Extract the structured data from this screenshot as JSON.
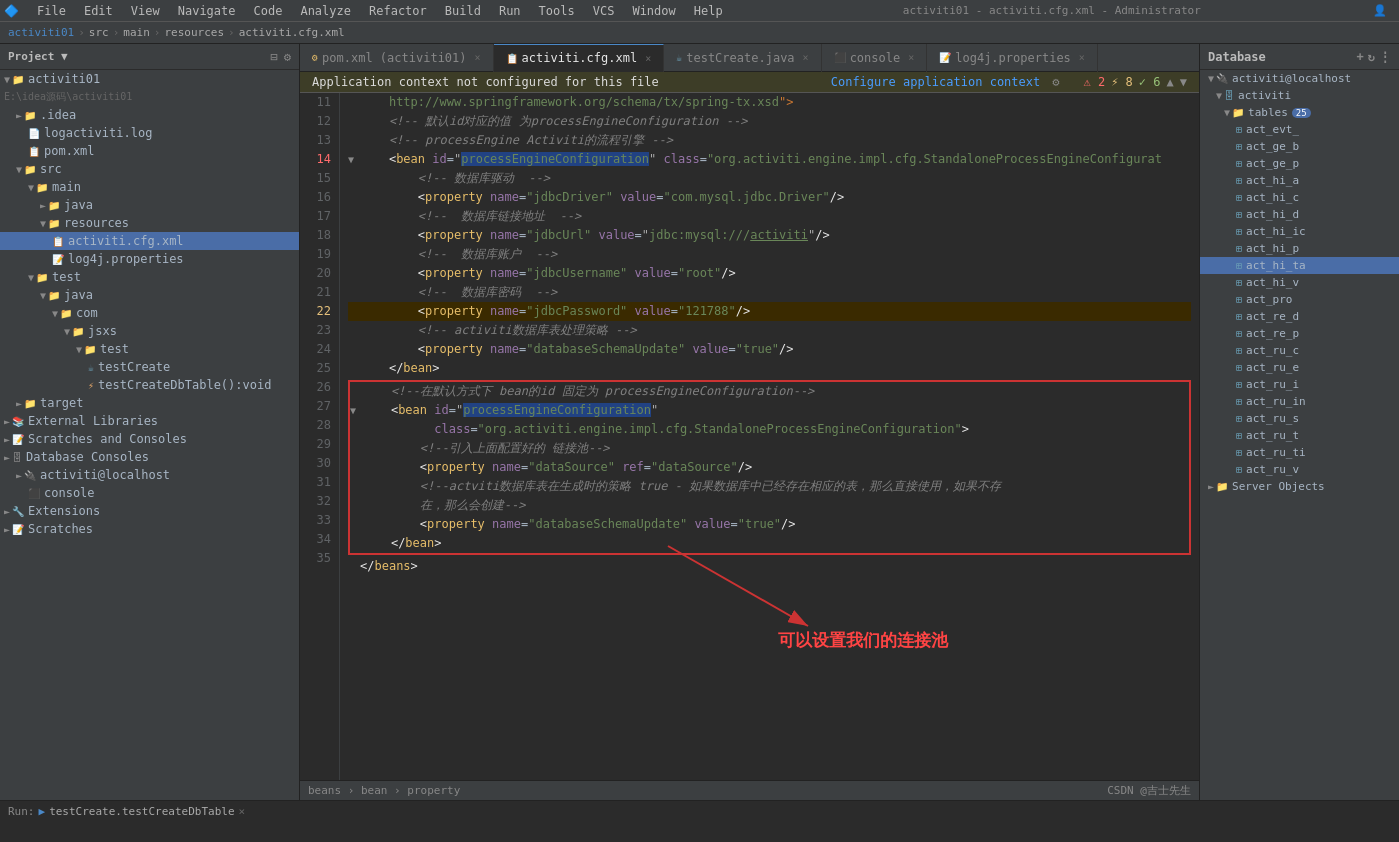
{
  "menuBar": {
    "items": [
      "File",
      "Edit",
      "View",
      "Navigate",
      "Code",
      "Analyze",
      "Refactor",
      "Build",
      "Run",
      "Tools",
      "VCS",
      "Window",
      "Help"
    ]
  },
  "windowTitle": "activiti01 - activiti.cfg.xml - Administrator",
  "breadcrumb": {
    "items": [
      "activiti01",
      "src",
      "main",
      "resources",
      "activiti.cfg.xml"
    ]
  },
  "tabs": [
    {
      "label": "pom.xml",
      "file": "pom.xml",
      "project": "activiti01",
      "active": false,
      "modified": false
    },
    {
      "label": "activiti.cfg.xml",
      "file": "activiti.cfg.xml",
      "active": true,
      "modified": false
    },
    {
      "label": "testCreate.java",
      "file": "testCreate.java",
      "active": false,
      "modified": false
    },
    {
      "label": "console",
      "file": "console",
      "active": false,
      "modified": false
    },
    {
      "label": "log4j.properties",
      "file": "log4j.properties",
      "active": false,
      "modified": false
    }
  ],
  "warningBar": {
    "message": "Application context not configured for this file",
    "configureLabel": "Configure application context"
  },
  "sidebar": {
    "title": "Project",
    "items": [
      {
        "label": "activiti01",
        "indent": 0,
        "type": "project",
        "arrow": "▼"
      },
      {
        "label": "E:\\idea源码\\activiti01",
        "indent": 0,
        "type": "path",
        "arrow": ""
      },
      {
        "label": ".idea",
        "indent": 1,
        "type": "folder",
        "arrow": "►"
      },
      {
        "label": "logactiviti.log",
        "indent": 1,
        "type": "file-log",
        "arrow": ""
      },
      {
        "label": "pom.xml",
        "indent": 1,
        "type": "file-xml",
        "arrow": ""
      },
      {
        "label": "src",
        "indent": 1,
        "type": "folder",
        "arrow": "▼"
      },
      {
        "label": "main",
        "indent": 2,
        "type": "folder",
        "arrow": "▼"
      },
      {
        "label": "java",
        "indent": 3,
        "type": "folder",
        "arrow": "►"
      },
      {
        "label": "resources",
        "indent": 3,
        "type": "folder",
        "arrow": "▼"
      },
      {
        "label": "activiti.cfg.xml",
        "indent": 4,
        "type": "file-xml",
        "arrow": "",
        "selected": true
      },
      {
        "label": "log4j.properties",
        "indent": 4,
        "type": "file-prop",
        "arrow": ""
      },
      {
        "label": "test",
        "indent": 2,
        "type": "folder",
        "arrow": "▼"
      },
      {
        "label": "java",
        "indent": 3,
        "type": "folder",
        "arrow": "▼"
      },
      {
        "label": "com",
        "indent": 4,
        "type": "folder",
        "arrow": "▼"
      },
      {
        "label": "jsxs",
        "indent": 5,
        "type": "folder",
        "arrow": "▼"
      },
      {
        "label": "test",
        "indent": 6,
        "type": "folder",
        "arrow": "▼"
      },
      {
        "label": "testCreate",
        "indent": 7,
        "type": "file-java",
        "arrow": ""
      },
      {
        "label": "testCreateDbTable():void",
        "indent": 7,
        "type": "file-method",
        "arrow": ""
      },
      {
        "label": "target",
        "indent": 1,
        "type": "folder",
        "arrow": "►"
      },
      {
        "label": "External Libraries",
        "indent": 0,
        "type": "folder",
        "arrow": "►"
      },
      {
        "label": "Scratches and Consoles",
        "indent": 0,
        "type": "folder",
        "arrow": "►"
      },
      {
        "label": "Database Consoles",
        "indent": 0,
        "type": "folder",
        "arrow": "►"
      },
      {
        "label": "activiti@localhost",
        "indent": 1,
        "type": "db",
        "arrow": "►"
      },
      {
        "label": "console",
        "indent": 2,
        "type": "console",
        "arrow": ""
      },
      {
        "label": "Extensions",
        "indent": 0,
        "type": "folder",
        "arrow": "►"
      },
      {
        "label": "Scratches",
        "indent": 0,
        "type": "folder",
        "arrow": "►"
      }
    ]
  },
  "dbPanel": {
    "title": "Database",
    "items": [
      {
        "label": "activiti@localhost",
        "indent": 0,
        "type": "db",
        "arrow": "▼"
      },
      {
        "label": "activiti",
        "indent": 1,
        "type": "schema",
        "arrow": "▼"
      },
      {
        "label": "tables",
        "indent": 2,
        "type": "folder",
        "arrow": "▼",
        "badge": "25"
      },
      {
        "label": "act_evt_",
        "indent": 3,
        "type": "table",
        "arrow": ""
      },
      {
        "label": "act_ge_b",
        "indent": 3,
        "type": "table",
        "arrow": ""
      },
      {
        "label": "act_ge_p",
        "indent": 3,
        "type": "table",
        "arrow": ""
      },
      {
        "label": "act_hi_a",
        "indent": 3,
        "type": "table",
        "arrow": ""
      },
      {
        "label": "act_hi_c",
        "indent": 3,
        "type": "table",
        "arrow": ""
      },
      {
        "label": "act_hi_d",
        "indent": 3,
        "type": "table",
        "arrow": ""
      },
      {
        "label": "act_hi_ic",
        "indent": 3,
        "type": "table",
        "arrow": ""
      },
      {
        "label": "act_hi_p",
        "indent": 3,
        "type": "table",
        "arrow": ""
      },
      {
        "label": "act_hi_ta",
        "indent": 3,
        "type": "table",
        "arrow": "",
        "selected": true
      },
      {
        "label": "act_hi_v",
        "indent": 3,
        "type": "table",
        "arrow": ""
      },
      {
        "label": "act_pro",
        "indent": 3,
        "type": "table",
        "arrow": ""
      },
      {
        "label": "act_re_d",
        "indent": 3,
        "type": "table",
        "arrow": ""
      },
      {
        "label": "act_re_p",
        "indent": 3,
        "type": "table",
        "arrow": ""
      },
      {
        "label": "act_ru_c",
        "indent": 3,
        "type": "table",
        "arrow": ""
      },
      {
        "label": "act_ru_e",
        "indent": 3,
        "type": "table",
        "arrow": ""
      },
      {
        "label": "act_ru_i",
        "indent": 3,
        "type": "table",
        "arrow": ""
      },
      {
        "label": "act_ru_in",
        "indent": 3,
        "type": "table",
        "arrow": ""
      },
      {
        "label": "act_ru_s",
        "indent": 3,
        "type": "table",
        "arrow": ""
      },
      {
        "label": "act_ru_t",
        "indent": 3,
        "type": "table",
        "arrow": ""
      },
      {
        "label": "act_ru_ti",
        "indent": 3,
        "type": "table",
        "arrow": ""
      },
      {
        "label": "act_ru_v",
        "indent": 3,
        "type": "table",
        "arrow": ""
      },
      {
        "label": "Server Objects",
        "indent": 0,
        "type": "folder",
        "arrow": "►"
      }
    ]
  },
  "codeLines": [
    {
      "num": 11,
      "content": "    http://www.springframework.org/schema/tx/spring-tx.xsd\">",
      "type": "normal"
    },
    {
      "num": 12,
      "content": "    <!-- 默认id对应的值 为processEngineConfiguration -->",
      "type": "comment"
    },
    {
      "num": 13,
      "content": "    <!-- processEngine Activiti的流程引擎 -->",
      "type": "comment"
    },
    {
      "num": 14,
      "content": "    <bean id=\"processEngineConfiguration\" class=\"org.activiti.engine.impl.cfg.StandaloneProcessEngineConfigurat",
      "type": "bean-highlight",
      "fold": true
    },
    {
      "num": 15,
      "content": "        <!-- 数据库驱动 -->",
      "type": "comment"
    },
    {
      "num": 16,
      "content": "        <property name=\"jdbcDriver\" value=\"com.mysql.jdbc.Driver\"/>",
      "type": "property"
    },
    {
      "num": 17,
      "content": "        <!--  数据库链接地址  -->",
      "type": "comment"
    },
    {
      "num": 18,
      "content": "        <property name=\"jdbcUrl\" value=\"jdbc:mysql:///activiti\"/>",
      "type": "property"
    },
    {
      "num": 19,
      "content": "        <!--  数据库账户  -->",
      "type": "comment"
    },
    {
      "num": 20,
      "content": "        <property name=\"jdbcUsername\" value=\"root\"/>",
      "type": "property"
    },
    {
      "num": 21,
      "content": "        <!--  数据库密码  -->",
      "type": "comment"
    },
    {
      "num": 22,
      "content": "        <property name=\"jdbcPassword\" value=\"121788\"/>",
      "type": "property-highlight"
    },
    {
      "num": 23,
      "content": "        <!-- activiti数据库表处理策略 -->",
      "type": "comment"
    },
    {
      "num": 24,
      "content": "        <property name=\"databaseSchemaUpdate\" value=\"true\"/>",
      "type": "property"
    },
    {
      "num": 25,
      "content": "    </bean>",
      "type": "normal"
    },
    {
      "num": 26,
      "content": "    <!--在默认方式下 bean的id 固定为 processEngineConfiguration-->",
      "type": "comment-box-start"
    },
    {
      "num": 27,
      "content": "    <bean id=\"processEngineConfiguration\"",
      "type": "bean-box",
      "fold": true
    },
    {
      "num": 28,
      "content": "          class=\"org.activiti.engine.impl.cfg.StandaloneProcessEngineConfiguration\">",
      "type": "bean-box"
    },
    {
      "num": 29,
      "content": "        <!--引入上面配置好的 链接池-->",
      "type": "comment-box"
    },
    {
      "num": 30,
      "content": "        <property name=\"dataSource\" ref=\"dataSource\"/>",
      "type": "property-box"
    },
    {
      "num": 31,
      "content": "        <!--actviti数据库表在生成时的策略 true - 如果数据库中已经存在相应的表，那么直接使用，如果不存",
      "type": "comment-box"
    },
    {
      "num": 32,
      "content": "        在，那么会创建-->",
      "type": "comment-box"
    },
    {
      "num": 33,
      "content": "        <property name=\"databaseSchemaUpdate\" value=\"true\"/>",
      "type": "property-box"
    },
    {
      "num": 34,
      "content": "    </bean>",
      "type": "normal-box-end"
    },
    {
      "num": 35,
      "content": "</beans>",
      "type": "normal"
    }
  ],
  "statusBar": {
    "breadcrumb": "beans › bean › property",
    "csdn": "CSDN @吉士先生"
  },
  "runBar": {
    "label": "Run:",
    "task": "testCreate.testCreateDbTable",
    "icon": "▶"
  },
  "annotation": {
    "text": "可以设置我们的连接池"
  },
  "errors": {
    "count": 2,
    "warnings": 8,
    "ok": 6
  }
}
